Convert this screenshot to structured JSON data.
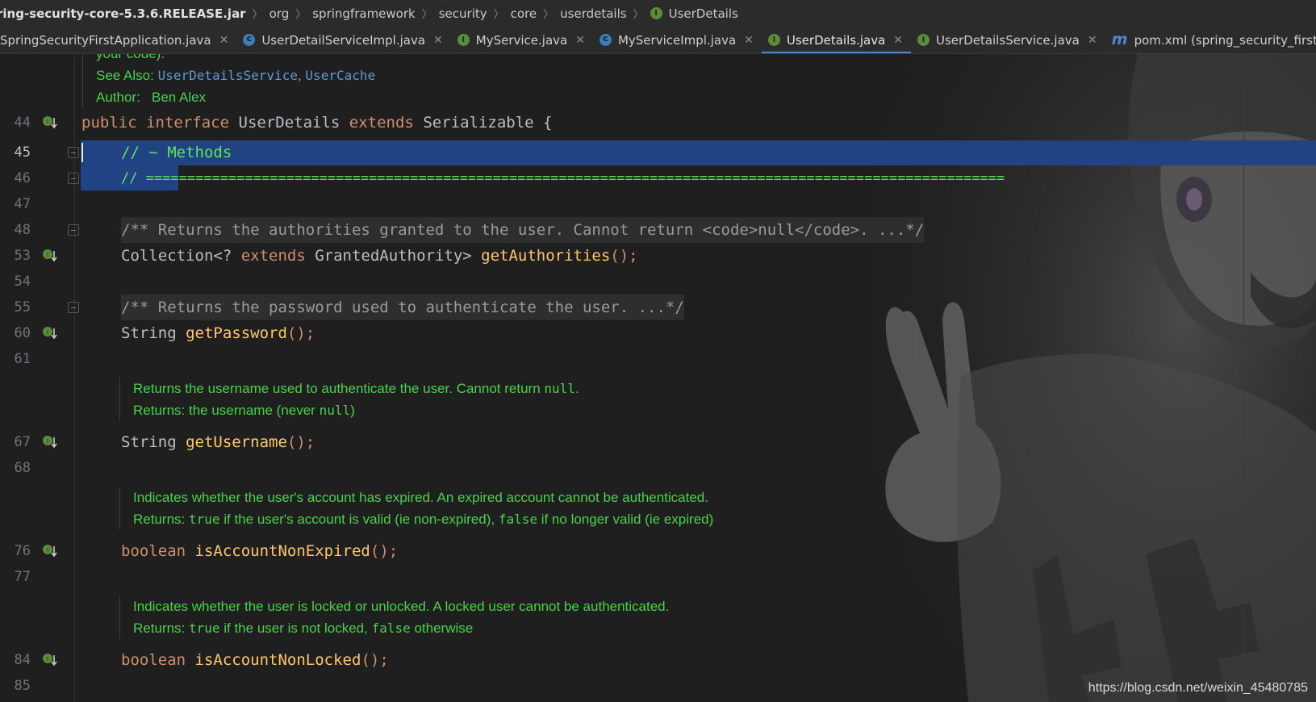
{
  "breadcrumb": {
    "items": [
      "ring-security-core-5.3.6.RELEASE.jar",
      "org",
      "springframework",
      "security",
      "core",
      "userdetails",
      "UserDetails"
    ]
  },
  "tabs": [
    {
      "label": "SpringSecurityFirstApplication.java",
      "icon": "class-icon"
    },
    {
      "label": "UserDetailServiceImpl.java",
      "icon": "class-icon"
    },
    {
      "label": "MyService.java",
      "icon": "interface-icon"
    },
    {
      "label": "MyServiceImpl.java",
      "icon": "class-icon"
    },
    {
      "label": "UserDetails.java",
      "icon": "interface-icon",
      "active": true
    },
    {
      "label": "UserDetailsService.java",
      "icon": "interface-icon"
    },
    {
      "label": "pom.xml (spring_security_first)",
      "icon": "maven-icon"
    }
  ],
  "top_doc": {
    "cut_line": "your code).",
    "see_also_label": "See Also:",
    "see_also_links": [
      "UserDetailsService",
      "UserCache"
    ],
    "see_also_sep": ",",
    "author_label": "Author:",
    "author": "Ben Alex"
  },
  "lines": {
    "n44": "44",
    "n45": "45",
    "n46": "46",
    "n47": "47",
    "n48": "48",
    "n53": "53",
    "n54": "54",
    "n55": "55",
    "n60": "60",
    "n61": "61",
    "n67": "67",
    "n68": "68",
    "n76": "76",
    "n77": "77",
    "n84": "84",
    "n85": "85"
  },
  "code": {
    "l44_public": "public",
    "l44_interface": "interface",
    "l44_name": "UserDetails",
    "l44_extends": "extends",
    "l44_rest": "Serializable {",
    "l45": "// ~ Methods",
    "l46": "// ========================================================================================================",
    "l48": "/** Returns the authorities granted to the user. Cannot return <code>null</code>. ...*/",
    "l53_a": "Collection<? ",
    "l53_extends": "extends",
    "l53_b": " GrantedAuthority> ",
    "l53_fn": "getAuthorities",
    "l53_end": "();",
    "l55": "/** Returns the password used to authenticate the user. ...*/",
    "l60_type": "String ",
    "l60_fn": "getPassword",
    "l60_end": "();",
    "l67_type": "String ",
    "l67_fn": "getUsername",
    "l67_end": "();",
    "l76_type": "boolean",
    "l76_fn": "isAccountNonExpired",
    "l76_end": "();",
    "l84_type": "boolean",
    "l84_fn": "isAccountNonLocked",
    "l84_end": "();"
  },
  "docs": {
    "username_line1": "Returns the username used to authenticate the user. Cannot return ",
    "username_null": "null",
    "username_dot": ".",
    "username_returns": "Returns: the username (never ",
    "username_null2": "null",
    "username_close": ")",
    "expired_line1": "Indicates whether the user's account has expired. An expired account cannot be authenticated.",
    "expired_returns": "Returns: ",
    "expired_true": "true",
    "expired_mid": " if the user's account is valid (ie non-expired), ",
    "expired_false": "false",
    "expired_end": " if no longer valid (ie expired)",
    "locked_line1": "Indicates whether the user is locked or unlocked. A locked user cannot be authenticated.",
    "locked_returns": "Returns: ",
    "locked_true": "true",
    "locked_mid": " if the user is not locked, ",
    "locked_false": "false",
    "locked_end": " otherwise"
  },
  "watermark": "https://blog.csdn.net/weixin_45480785",
  "colors": {
    "keyword": "#cf8e6d",
    "method": "#ffc66d",
    "comment": "#5fe35f",
    "doc_text": "#49d24a",
    "link": "#5d9bd8",
    "selection": "#214283",
    "tab_underline": "#4a88c7"
  }
}
